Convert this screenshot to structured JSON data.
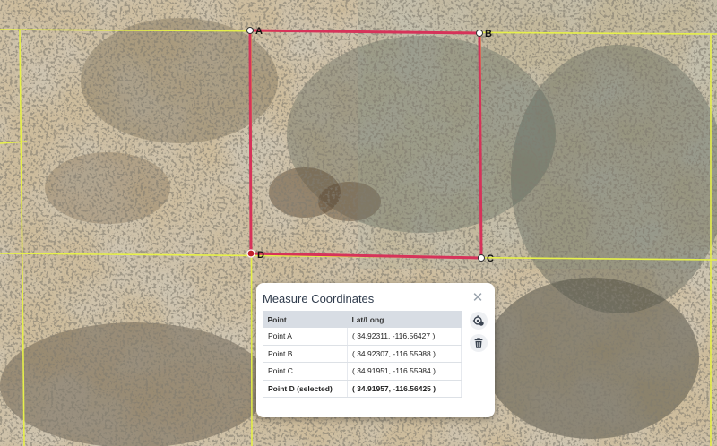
{
  "map": {
    "points": [
      {
        "label": "A",
        "marker_color": "#ffffff"
      },
      {
        "label": "B",
        "marker_color": "#ffffff"
      },
      {
        "label": "C",
        "marker_color": "#ffffff"
      },
      {
        "label": "D",
        "marker_color": "#c0202a"
      }
    ],
    "polygon_color": "#d6335a",
    "grid_color": "#e6f04a",
    "icons": [
      "close-icon",
      "locate-icon",
      "trash-icon"
    ]
  },
  "panel": {
    "title": "Measure Coordinates",
    "columns": [
      "Point",
      "Lat/Long"
    ],
    "rows": [
      {
        "point": "Point A",
        "latlong": "( 34.92311, -116.56427 )"
      },
      {
        "point": "Point B",
        "latlong": "( 34.92307, -116.55988 )"
      },
      {
        "point": "Point C",
        "latlong": "( 34.91951, -116.55984 )"
      },
      {
        "point": "Point D (selected)",
        "latlong": "( 34.91957, -116.56425 )"
      }
    ]
  }
}
